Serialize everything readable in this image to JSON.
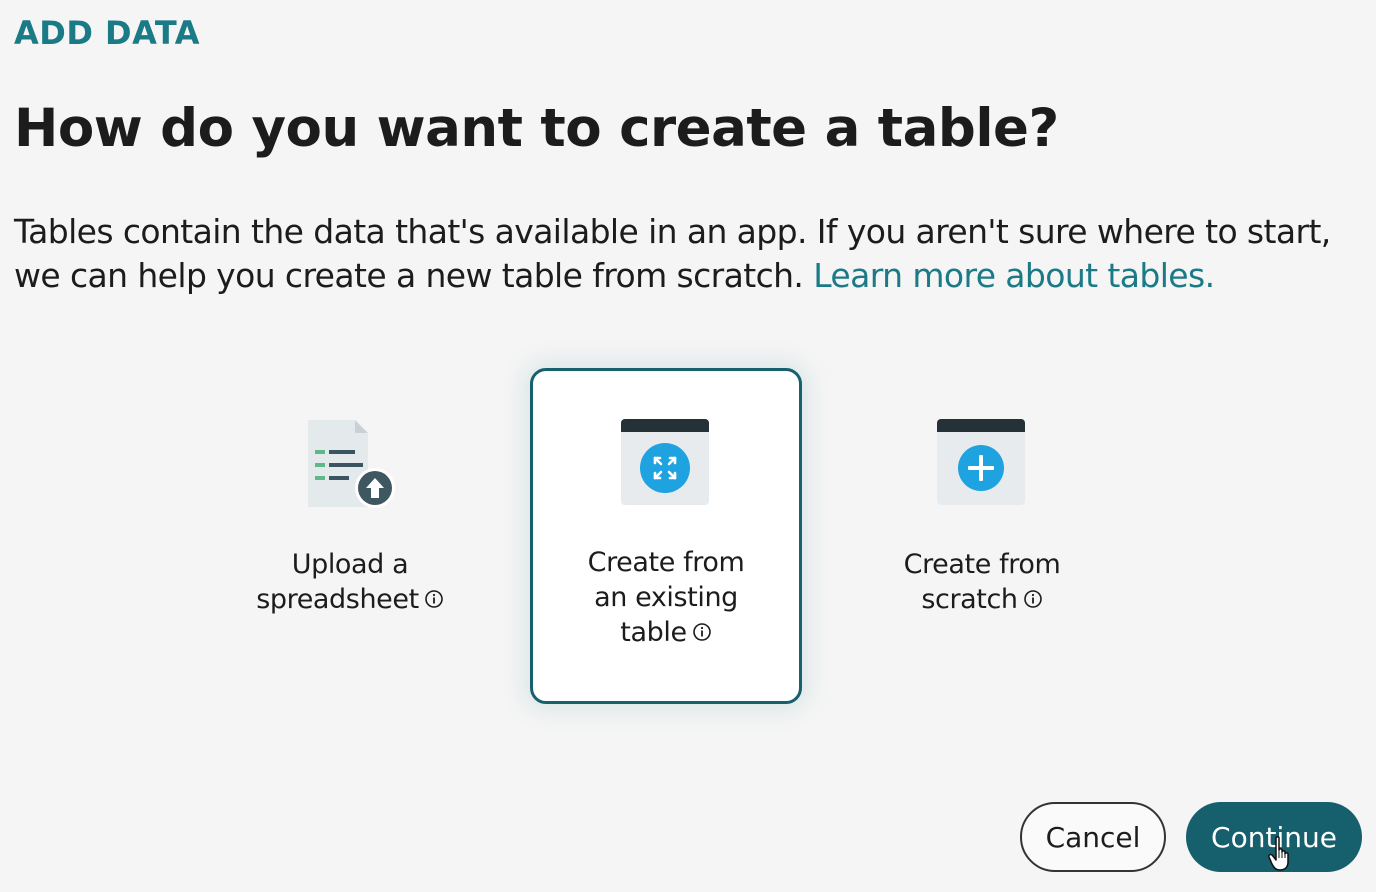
{
  "header": {
    "eyebrow": "ADD DATA",
    "title": "How do you want to create a table?"
  },
  "description": {
    "text_line1": "Tables contain the data that's available in an app. If you aren't sure where to start,",
    "text_line2": "we can help you create a new table from scratch.",
    "link": "Learn more about tables."
  },
  "options": [
    {
      "label_lines": [
        "Upload a",
        "spreadsheet"
      ],
      "icon": "spreadsheet-upload-icon",
      "selected": false
    },
    {
      "label_lines": [
        "Create from",
        "an existing",
        "table"
      ],
      "icon": "expand-table-icon",
      "selected": true
    },
    {
      "label_lines": [
        "Create from",
        "scratch"
      ],
      "icon": "add-table-icon",
      "selected": false
    }
  ],
  "footer": {
    "cancel_label": "Cancel",
    "continue_label": "Continue"
  },
  "colors": {
    "accent": "#1a7a86",
    "primary_button": "#16606d",
    "icon_blue": "#1ea3e0",
    "icon_dark": "#243238"
  }
}
